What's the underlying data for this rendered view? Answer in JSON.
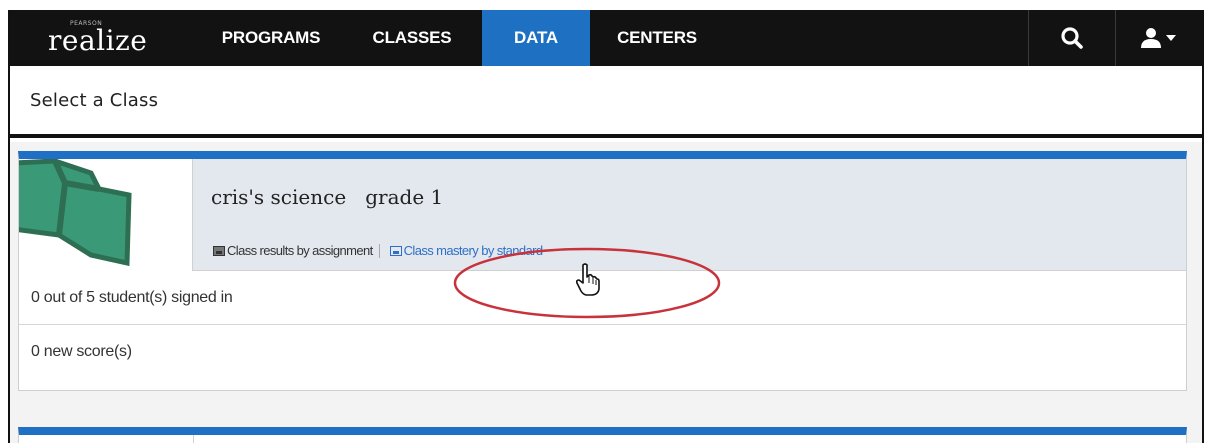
{
  "brand": {
    "small_text": "PEARSON",
    "name": "realize"
  },
  "nav": {
    "items": [
      {
        "label": "PROGRAMS",
        "active": false
      },
      {
        "label": "CLASSES",
        "active": false
      },
      {
        "label": "DATA",
        "active": true
      },
      {
        "label": "CENTERS",
        "active": false
      }
    ],
    "icons": [
      "search-icon",
      "user-menu-icon"
    ]
  },
  "page": {
    "select_label": "Select a Class"
  },
  "class_card": {
    "title": "cris's science   grade 1",
    "links": {
      "by_assignment": "Class results by assignment",
      "by_standard": "Class mastery by standard"
    },
    "signed_in": "0 out of 5 student(s) signed in",
    "new_scores": "0 new score(s)"
  },
  "colors": {
    "nav_bg": "#121212",
    "active_tab": "#1d70c2",
    "card_accent": "#1f6fc4",
    "highlight_circle": "#c8323a",
    "link": "#2f6fc6",
    "thumbnail": "#3a9a78"
  }
}
